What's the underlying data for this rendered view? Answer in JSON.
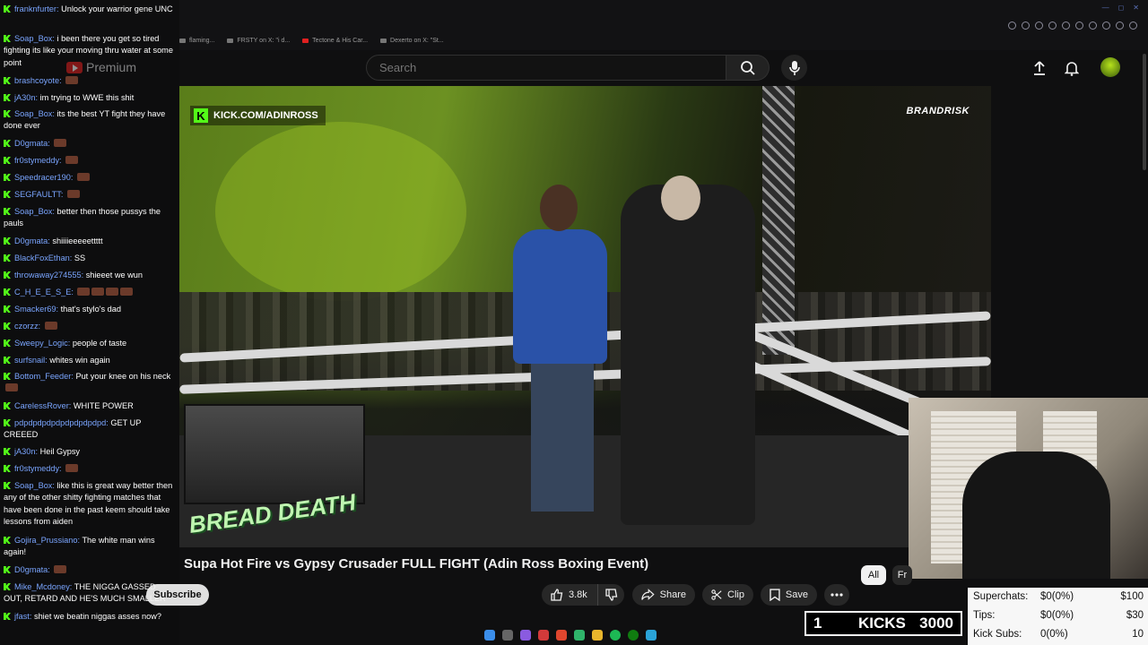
{
  "browser": {
    "address_url": "www.youtube.com/watch",
    "tabs": [
      {
        "label": "flaming..."
      },
      {
        "label": "FRSTY on X: \"i d..."
      },
      {
        "label": "Tectone & His Car..."
      },
      {
        "label": "Dexerto on X: \"St..."
      }
    ]
  },
  "header": {
    "logo_label": "Premium",
    "search_placeholder": "Search"
  },
  "video": {
    "title": "Supa Hot Fire vs Gypsy Crusader FULL FIGHT (Adin Ross Boxing Event)",
    "kick_url": "KICK.COM/ADINROSS",
    "brand": "BRANDRISK",
    "event_logo": "BREAD DEATH",
    "likes": "3.8k",
    "share_label": "Share",
    "clip_label": "Clip",
    "save_label": "Save",
    "subscribe_label": "Subscribe"
  },
  "chips": {
    "all": "All",
    "fr": "Fr"
  },
  "chat": [
    {
      "user": "franknfurter",
      "text": "Unlock your warrior gene UNC",
      "emotes": 0
    },
    {
      "user": "Soap_Box",
      "text": "i been there you get so tired fighting its like your moving thru water at some point",
      "emotes": 0
    },
    {
      "user": "brashcoyote",
      "text": "",
      "emotes": 1
    },
    {
      "user": "jA30n",
      "text": "im trying to WWE this shit",
      "emotes": 0
    },
    {
      "user": "Soap_Box",
      "text": "its the best YT fight they have done ever",
      "emotes": 0
    },
    {
      "user": "D0gmata",
      "text": "",
      "emotes": 1
    },
    {
      "user": "fr0stymeddy",
      "text": "",
      "emotes": 1
    },
    {
      "user": "Speedracer190",
      "text": "",
      "emotes": 1
    },
    {
      "user": "SEGFAULTT",
      "text": "",
      "emotes": 1
    },
    {
      "user": "Soap_Box",
      "text": "better then those pussys the pauls",
      "emotes": 0
    },
    {
      "user": "D0gmata",
      "text": "shiiiieeeeettttt",
      "emotes": 0
    },
    {
      "user": "BlackFoxEthan",
      "text": "SS",
      "emotes": 0
    },
    {
      "user": "throwaway274555",
      "text": "shieeet we wun",
      "emotes": 0
    },
    {
      "user": "C_H_E_E_S_E",
      "text": "",
      "emotes": 4
    },
    {
      "user": "Smacker69",
      "text": "that's stylo's dad",
      "emotes": 0
    },
    {
      "user": "czorzz",
      "text": "",
      "emotes": 1
    },
    {
      "user": "Sweepy_Logic",
      "text": "people of taste",
      "emotes": 0
    },
    {
      "user": "surfsnail",
      "text": "whites win again",
      "emotes": 0
    },
    {
      "user": "Bottom_Feeder",
      "text": "Put your knee on his neck",
      "emotes": 1
    },
    {
      "user": "CarelessRover",
      "text": "WHITE POWER",
      "emotes": 0
    },
    {
      "user": "pdpdpdpdpdpdpdpdpdpd",
      "text": "GET UP CREEED",
      "emotes": 0
    },
    {
      "user": "jA30n",
      "text": "Heil Gypsy",
      "emotes": 0
    },
    {
      "user": "fr0stymeddy",
      "text": "",
      "emotes": 1
    },
    {
      "user": "Soap_Box",
      "text": "like this is great way better then any of the other shitty fighting matches that have been done in the past keem should take lessons from aiden",
      "emotes": 0
    },
    {
      "user": "Gojira_Prussiano",
      "text": "The white man wins again!",
      "emotes": 0
    },
    {
      "user": "D0gmata",
      "text": "",
      "emotes": 1
    },
    {
      "user": "Mike_Mcdoney",
      "text": "THE NIGGA GASSED OUT, RETARD AND HE'S MUCH SMALLER",
      "emotes": 0
    },
    {
      "user": "jfast",
      "text": "shiet we beatin niggas asses now?",
      "emotes": 0
    }
  ],
  "stats": {
    "superchats_label": "Superchats:",
    "superchats_value": "$0(0%)",
    "superchats_goal": "$100",
    "tips_label": "Tips:",
    "tips_value": "$0(0%)",
    "tips_goal": "$30",
    "subs_label": "Kick Subs:",
    "subs_value": "0(0%)",
    "subs_goal": "10"
  },
  "kicks": {
    "count": "1",
    "label": "KICKS",
    "goal": "3000"
  },
  "colors": {
    "kick_green": "#53fc18",
    "chat_user": "#7aa5ff",
    "youtube_red": "#e02020"
  }
}
